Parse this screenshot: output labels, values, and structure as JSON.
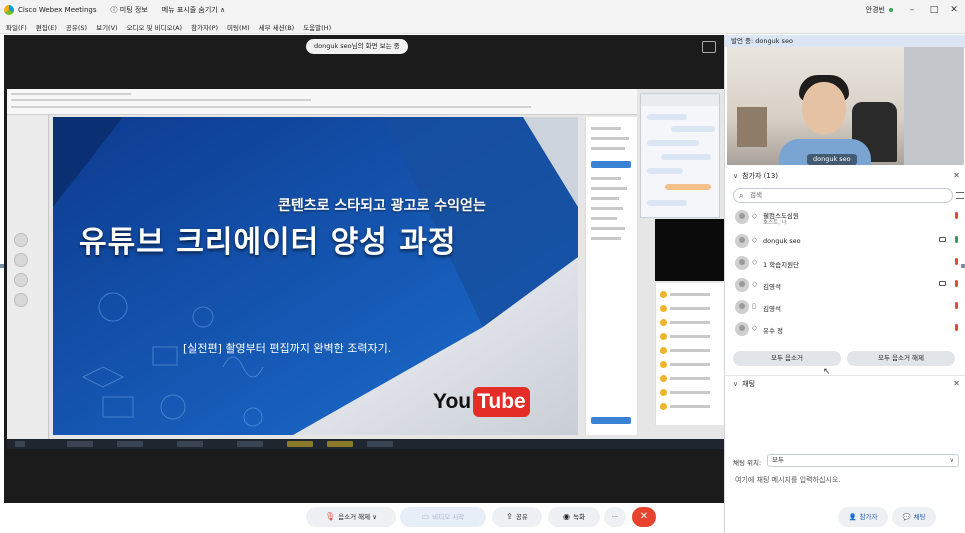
{
  "titlebar": {
    "app_title": "Cisco Webex Meetings",
    "meeting_info": "ⓘ 미팅 정보",
    "hide_menu": "메뉴 표시줄 숨기기 ∧",
    "user": "안경빈"
  },
  "menu": [
    "파일(F)",
    "편집(E)",
    "공유(S)",
    "보기(V)",
    "오디오 및 비디오(A)",
    "참가자(P)",
    "미팅(M)",
    "세부 세션(B)",
    "도움말(H)"
  ],
  "stage": {
    "share_status": "donguk seo님의 화면 보는 중"
  },
  "slide": {
    "subtitle": "콘텐츠로 스타되고 광고로 수익얻는",
    "title": "유튜브 크리에이터 양성 과정",
    "description": "[실전편] 촬영부터 편집까지 완벽한 조력자기.",
    "logo_you": "You",
    "logo_tube": "Tube"
  },
  "speaker_panel": {
    "label": "발언 중: donguk seo",
    "video_name": "donguk seo"
  },
  "participants": {
    "header": "참가자 (13)",
    "search_placeholder": "검색",
    "rows": [
      {
        "name": "웰컴스도심원",
        "role": "호스트, 나",
        "mic": "off",
        "camera": false
      },
      {
        "name": "donguk seo",
        "role": "",
        "mic": "on",
        "camera": true
      },
      {
        "name": "1 학습지원단",
        "role": "",
        "mic": "off",
        "camera": false
      },
      {
        "name": "김영석",
        "role": "",
        "mic": "off",
        "camera": true
      },
      {
        "name": "김영석",
        "role": "",
        "mic": "off",
        "camera": false
      },
      {
        "name": "유수 정",
        "role": "",
        "mic": "off",
        "camera": false
      }
    ],
    "mute_all": "모두 음소거",
    "unmute_all": "모두 음소거 해제"
  },
  "chat": {
    "header": "채팅",
    "send_to_label": "채팅 위치:",
    "send_to_value": "모두",
    "input_placeholder": "여기에 채팅 메시지를 입력하십시오."
  },
  "controls": {
    "unmute": "음소거 해제",
    "start_video": "비디오 시작",
    "share": "공유",
    "record": "녹화",
    "more": "···",
    "end": "✕"
  },
  "right_controls": {
    "participants": "참가자",
    "chat": "채팅"
  }
}
